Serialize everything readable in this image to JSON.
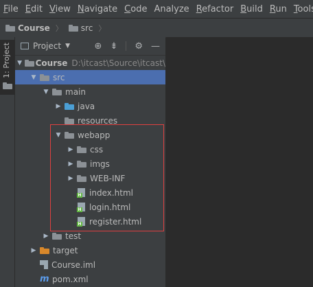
{
  "menu": [
    "File",
    "Edit",
    "View",
    "Navigate",
    "Code",
    "Analyze",
    "Refactor",
    "Build",
    "Run",
    "Tools"
  ],
  "menu_mnemonic": [
    "F",
    "E",
    "V",
    "N",
    "C",
    "",
    "R",
    "B",
    "R",
    "T"
  ],
  "breadcrumb": {
    "project": "Course",
    "folder": "src"
  },
  "tool_window_tab": "1: Project",
  "panel": {
    "title": "Project"
  },
  "tree": {
    "root": {
      "name": "Course",
      "path": "D:\\itcast\\Source\\itcast\\"
    },
    "src": "src",
    "main": "main",
    "java": "java",
    "resources": "resources",
    "webapp": "webapp",
    "css": "css",
    "imgs": "imgs",
    "webinf": "WEB-INF",
    "index": "index.html",
    "login": "login.html",
    "register": "register.html",
    "test": "test",
    "target": "target",
    "iml": "Course.iml",
    "pom": "pom.xml"
  },
  "colors": {
    "selection": "#4b6eaf",
    "highlight_box": "#e04040",
    "source_folder": "#4b9fd5",
    "excluded_folder": "#d9882a"
  }
}
